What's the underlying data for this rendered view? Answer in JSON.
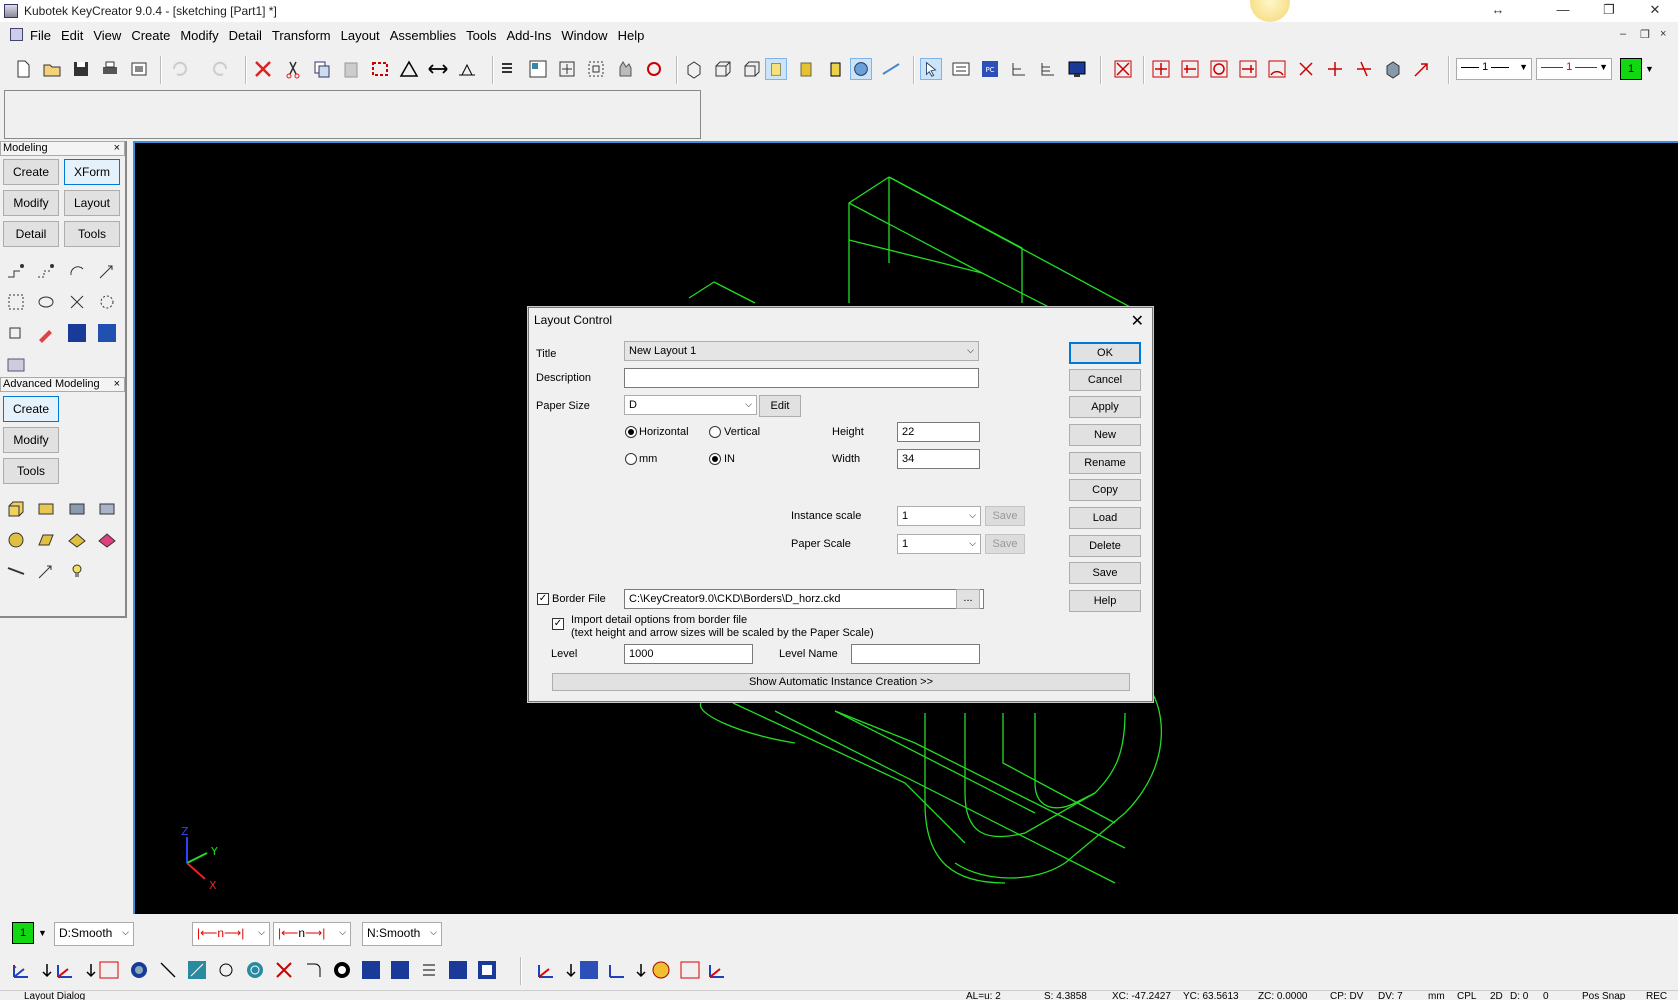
{
  "window": {
    "title": "Kubotek KeyCreator 9.0.4 - [sketching [Part1] *]",
    "controls": {
      "resize_glyph": "↔",
      "minimize": "—",
      "restore": "❐",
      "close": "✕"
    }
  },
  "menubar": {
    "items": [
      "File",
      "Edit",
      "View",
      "Create",
      "Modify",
      "Detail",
      "Transform",
      "Layout",
      "Assemblies",
      "Tools",
      "Add-Ins",
      "Window",
      "Help"
    ],
    "mdi_controls": {
      "minimize": "–",
      "restore": "❐",
      "close": "×"
    }
  },
  "toolbar": {
    "line_style_value": "1",
    "line_width_value": "1",
    "current_color": "1",
    "current_color_hex": "#12d812"
  },
  "modeling_panel": {
    "title": "Modeling",
    "close": "×",
    "buttons": [
      "Create",
      "XForm",
      "Modify",
      "Layout",
      "Detail",
      "Tools"
    ],
    "selected": "XForm"
  },
  "advanced_panel": {
    "title": "Advanced Modeling",
    "close": "×",
    "buttons": [
      "Create",
      "Modify",
      "Tools"
    ],
    "selected": "Create"
  },
  "viewport": {
    "background": "#000000",
    "wire_color": "#22dd22",
    "triad": {
      "z": "Z",
      "y": "Y",
      "x": "X"
    }
  },
  "bottom": {
    "color_value": "1",
    "display_mode": "D:Smooth",
    "normal_mode": "N:Smooth",
    "dim1": "n",
    "dim2": "n"
  },
  "status": {
    "left_text": "Layout Dialog",
    "al": "AL=u: 2",
    "s": "S: 4.3858",
    "xc": "XC: -47.2427",
    "yc": "YC: 63.5613",
    "zc": "ZC: 0.0000",
    "cp": "CP: DV",
    "dv": "DV: 7",
    "mm": "mm",
    "cpl": "CPL",
    "d": "2D",
    "dd": "D: 0",
    "o": "0",
    "pos": "Pos Snap",
    "rec": "REC"
  },
  "dialog": {
    "title": "Layout Control",
    "title_label": "Title",
    "title_value": "New Layout 1",
    "description_label": "Description",
    "description_value": "",
    "paper_size_label": "Paper Size",
    "paper_size_value": "D",
    "edit_button": "Edit",
    "orientation_horizontal": "Horizontal",
    "orientation_vertical": "Vertical",
    "unit_mm": "mm",
    "unit_in": "IN",
    "height_label": "Height",
    "height_value": "22",
    "width_label": "Width",
    "width_value": "34",
    "instance_scale_label": "Instance scale",
    "instance_scale_value": "1",
    "paper_scale_label": "Paper Scale",
    "paper_scale_value": "1",
    "save_disabled": "Save",
    "border_file_label": "Border File",
    "border_file_value": "C:\\KeyCreator9.0\\CKD\\Borders\\D_horz.ckd",
    "browse_button": "...",
    "import_line1": "Import detail options from border file",
    "import_line2": "(text height and arrow sizes will be scaled by the Paper Scale)",
    "level_label": "Level",
    "level_value": "1000",
    "level_name_label": "Level Name",
    "level_name_value": "",
    "show_auto_button": "Show Automatic Instance Creation >>",
    "side_buttons": [
      "OK",
      "Cancel",
      "Apply",
      "New",
      "Rename",
      "Copy",
      "Load",
      "Delete",
      "Save",
      "Help"
    ]
  }
}
